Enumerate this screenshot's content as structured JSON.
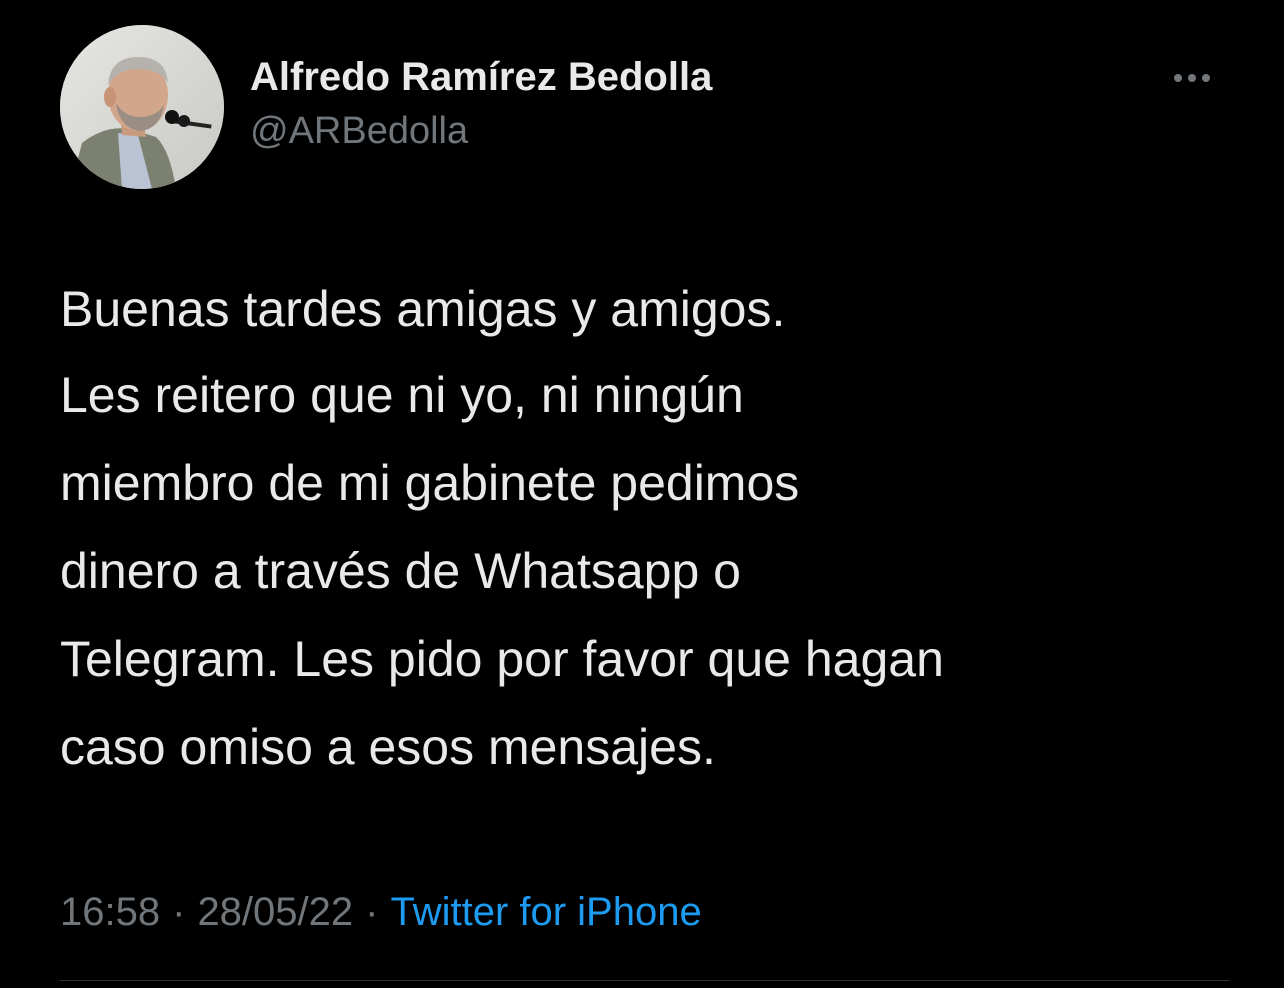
{
  "author": {
    "display_name": "Alfredo Ramírez Bedolla",
    "handle": "@ARBedolla"
  },
  "tweet": {
    "paragraphs": [
      [
        "Buenas tardes amigas y amigos."
      ],
      [
        "Les reitero que ni yo, ni ningún",
        "miembro de mi gabinete pedimos",
        "dinero a través de Whatsapp o",
        "Telegram. Les pido por favor que hagan",
        "caso omiso a esos mensajes."
      ]
    ]
  },
  "meta": {
    "time": "16:58",
    "separator": "·",
    "date": "28/05/22",
    "source": "Twitter for iPhone"
  },
  "icons": {
    "more": "more-horizontal-icon"
  },
  "colors": {
    "background": "#000000",
    "text": "#e7e9ea",
    "secondary": "#71767b",
    "accent": "#1d9bf0"
  }
}
